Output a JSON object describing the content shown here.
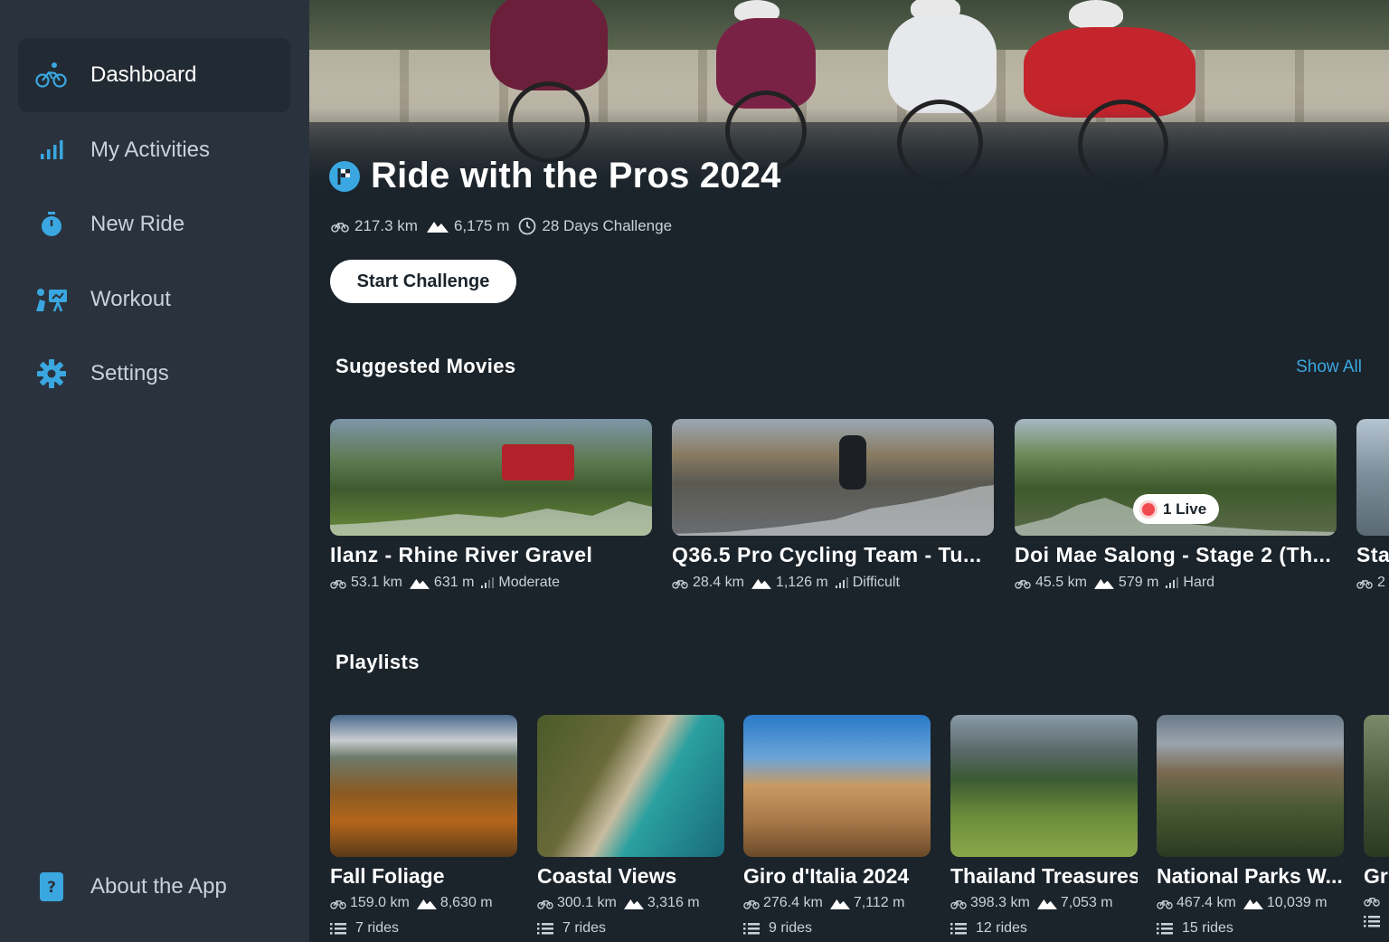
{
  "sidebar": {
    "items": [
      {
        "label": "Dashboard",
        "icon": "cyclist-icon",
        "active": true
      },
      {
        "label": "My Activities",
        "icon": "bar-chart-icon"
      },
      {
        "label": "New Ride",
        "icon": "stopwatch-icon"
      },
      {
        "label": "Workout",
        "icon": "workout-icon"
      },
      {
        "label": "Settings",
        "icon": "gear-icon"
      }
    ],
    "about": {
      "label": "About the App",
      "icon": "question-icon"
    }
  },
  "hero": {
    "title": "Ride with the Pros 2024",
    "distance": "217.3 km",
    "elevation": "6,175 m",
    "duration": "28 Days Challenge",
    "cta": "Start Challenge"
  },
  "suggested": {
    "title": "Suggested Movies",
    "show_all": "Show All",
    "movies": [
      {
        "title": "Ilanz - Rhine River Gravel",
        "distance": "53.1 km",
        "elevation": "631 m",
        "difficulty": "Moderate"
      },
      {
        "title": "Q36.5 Pro Cycling Team - Tu...",
        "distance": "28.4 km",
        "elevation": "1,126 m",
        "difficulty": "Difficult"
      },
      {
        "title": "Doi Mae Salong - Stage 2 (Th...",
        "distance": "45.5 km",
        "elevation": "579 m",
        "difficulty": "Hard",
        "live": "1 Live"
      },
      {
        "title": "Sta",
        "distance": "2"
      }
    ]
  },
  "playlists": {
    "title": "Playlists",
    "items": [
      {
        "title": "Fall Foliage",
        "distance": "159.0 km",
        "elevation": "8,630 m",
        "rides": "7 rides"
      },
      {
        "title": "Coastal Views",
        "distance": "300.1 km",
        "elevation": "3,316 m",
        "rides": "7 rides"
      },
      {
        "title": "Giro d'Italia 2024",
        "distance": "276.4 km",
        "elevation": "7,112 m",
        "rides": "9 rides"
      },
      {
        "title": "Thailand Treasures",
        "distance": "398.3 km",
        "elevation": "7,053 m",
        "rides": "12 rides"
      },
      {
        "title": "National Parks W...",
        "distance": "467.4 km",
        "elevation": "10,039 m",
        "rides": "15 rides"
      },
      {
        "title": "Gr"
      }
    ]
  },
  "colors": {
    "accent": "#3aa7e0",
    "background": "#1b232b",
    "sidebar": "#2a333d",
    "live": "#f2494f"
  }
}
